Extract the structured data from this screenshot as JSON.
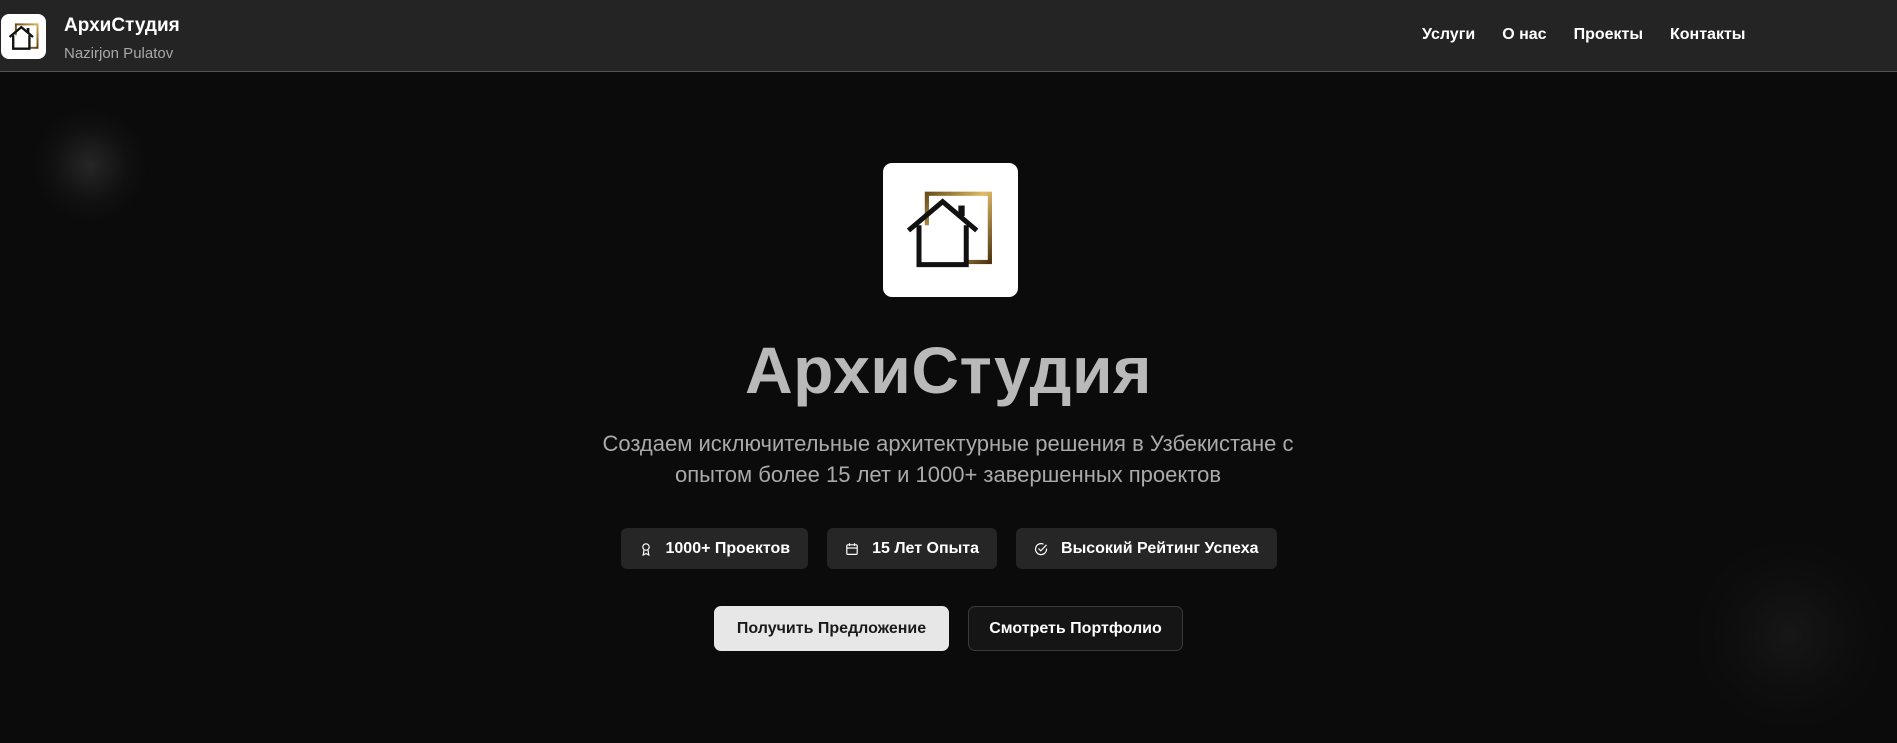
{
  "header": {
    "brand_name": "АрхиСтудия",
    "brand_owner": "Nazirjon Pulatov",
    "nav": [
      "Услуги",
      "О нас",
      "Проекты",
      "Контакты"
    ]
  },
  "hero": {
    "title": "АрхиСтудия",
    "subtitle": "Создаем исключительные архитектурные решения в Узбекистане с опытом более 15 лет и 1000+ завершенных проектов",
    "badges": [
      {
        "icon": "award-icon",
        "label": "1000+ Проектов"
      },
      {
        "icon": "calendar-icon",
        "label": "15 Лет Опыта"
      },
      {
        "icon": "check-circle-icon",
        "label": "Высокий Рейтинг Успеха"
      }
    ],
    "primary_button": "Получить Предложение",
    "secondary_button": "Смотреть Портфолио"
  },
  "colors": {
    "background": "#0b0b0b",
    "navbar": "#242424",
    "badge_bg": "#262626",
    "gold_accent": "#b8903e",
    "primary_button_bg": "#e7e7e7"
  }
}
